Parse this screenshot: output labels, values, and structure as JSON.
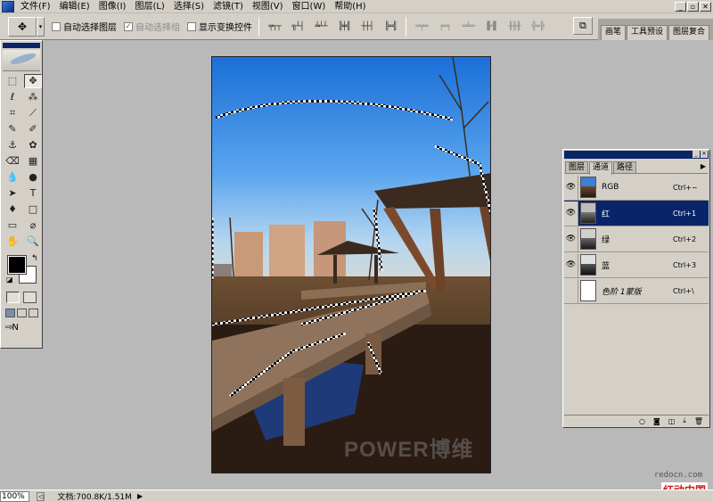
{
  "menubar": {
    "items": [
      "文件(F)",
      "编辑(E)",
      "图像(I)",
      "图层(L)",
      "选择(S)",
      "滤镜(T)",
      "视图(V)",
      "窗口(W)",
      "帮助(H)"
    ],
    "window_controls": [
      "_",
      "▫",
      "✕"
    ]
  },
  "options": {
    "auto_select_layer": "自动选择图层",
    "auto_select_group": "自动选择组",
    "show_transform": "显示变换控件",
    "preset_arrow": "▾",
    "align_buttons": [
      "╤┬┬",
      "╗┴┤",
      "╧┴┴",
      "╠╪╣",
      "┼┼┤",
      "╠═╣"
    ],
    "distribute_buttons": [
      "═╤═",
      "╒═╕",
      "═╧═",
      "▐═▌",
      "╫╫╫",
      "╣═╠"
    ],
    "well_tabs": [
      "画笔",
      "工具预设",
      "图层复合"
    ]
  },
  "toolbox": {
    "tools": [
      "⬚",
      "✥",
      "ℓ",
      "⁂",
      "⌗",
      "⟋",
      "✎",
      "✐",
      "⚓",
      "✿",
      "⌫",
      "▦",
      "💧",
      "●",
      "➤",
      "T",
      "♦",
      "□",
      "▭",
      "⌀",
      "✋",
      "🔍"
    ]
  },
  "document": {
    "watermark": "POWER博维"
  },
  "channels_panel": {
    "tabs": [
      "图层",
      "通道",
      "路径"
    ],
    "active_tab": 1,
    "channels": [
      {
        "name": "RGB",
        "shortcut": "Ctrl+~",
        "visible": true,
        "selected": false,
        "thumb": "color"
      },
      {
        "name": "红",
        "shortcut": "Ctrl+1",
        "visible": true,
        "selected": true,
        "thumb": "gray"
      },
      {
        "name": "绿",
        "shortcut": "Ctrl+2",
        "visible": true,
        "selected": false,
        "thumb": "gray"
      },
      {
        "name": "蓝",
        "shortcut": "Ctrl+3",
        "visible": true,
        "selected": false,
        "thumb": "gray"
      },
      {
        "name": "色阶 1蒙版",
        "shortcut": "Ctrl+\\",
        "visible": false,
        "selected": false,
        "thumb": "white"
      }
    ],
    "footer_icons": [
      "○",
      "◙",
      "◫",
      "⤓",
      "🗑"
    ]
  },
  "statusbar": {
    "zoom": "100%",
    "doc_size": "文档:700.8K/1.51M",
    "arrow": "▶"
  },
  "site": {
    "url": "redocn.com",
    "logo": "红动中国"
  }
}
